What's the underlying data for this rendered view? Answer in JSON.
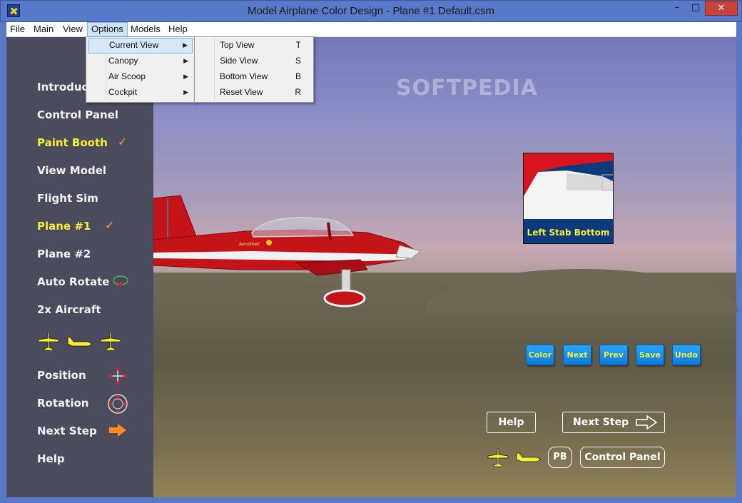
{
  "window": {
    "title": "Model Airplane Color Design - Plane #1  Default.csm",
    "min_glyph": "–",
    "max_glyph": "□",
    "close_glyph": "✕"
  },
  "menubar": {
    "items": [
      "File",
      "Main",
      "View",
      "Options",
      "Models",
      "Help"
    ],
    "active": "Options"
  },
  "options_menu": {
    "items": [
      {
        "label": "Current View",
        "has_submenu": true,
        "highlighted": true
      },
      {
        "label": "Canopy",
        "has_submenu": true
      },
      {
        "label": "Air Scoop",
        "has_submenu": true
      },
      {
        "label": "Cockpit",
        "has_submenu": true
      }
    ]
  },
  "current_view_submenu": {
    "items": [
      {
        "label": "Top View",
        "shortcut": "T"
      },
      {
        "label": "Side View",
        "shortcut": "S"
      },
      {
        "label": "Bottom View",
        "shortcut": "B"
      },
      {
        "label": "Reset View",
        "shortcut": "R"
      }
    ]
  },
  "left_nav": {
    "items": [
      {
        "label": "Introduc",
        "selected": false
      },
      {
        "label": "Control Panel",
        "selected": false
      },
      {
        "label": "Paint Booth",
        "selected": true,
        "checked": true
      },
      {
        "label": "View Model",
        "selected": false
      },
      {
        "label": "Flight Sim",
        "selected": false
      },
      {
        "label": "Plane #1",
        "selected": true,
        "checked": true
      },
      {
        "label": "Plane #2",
        "selected": false
      },
      {
        "label": "Auto Rotate",
        "selected": false
      },
      {
        "label": "2x Aircraft",
        "selected": false
      },
      {
        "label": "Position",
        "selected": false
      },
      {
        "label": "Rotation",
        "selected": false
      },
      {
        "label": "Next Step",
        "selected": false
      },
      {
        "label": "Help",
        "selected": false
      }
    ],
    "check_glyph": "✓"
  },
  "scene": {
    "watermark": "SOFTPEDIA",
    "plane_text": "AeroShell",
    "swatch_label": "Left Stab Bottom"
  },
  "actions": {
    "buttons": [
      "Color",
      "Next",
      "Prev",
      "Save",
      "Undo"
    ]
  },
  "bottom_controls": {
    "help_label": "Help",
    "next_step_label": "Next Step",
    "pb_label": "PB",
    "control_panel_label": "Control Panel"
  },
  "colors": {
    "panel_bg": "#4a4b5c",
    "selected_text": "#f6ee2e",
    "check": "#ff9a2e",
    "action_button": "#1590ee",
    "plane_red": "#c4141a"
  }
}
